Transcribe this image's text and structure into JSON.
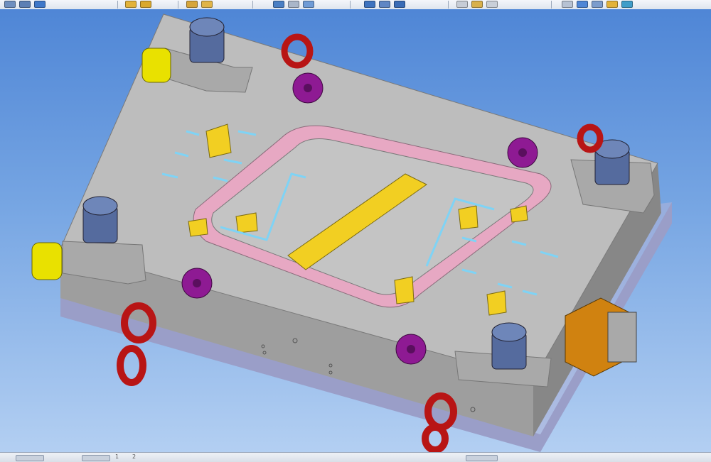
{
  "app": {
    "accent": "#4f86d6",
    "toolbar_icons": [
      "pointer-icon",
      "axis-icon",
      "move-icon",
      "folder-open-icon",
      "folder-icon",
      "assembly-icon",
      "open-assembly-icon",
      "part-icon",
      "sheet-icon",
      "view-icon",
      "window-icon",
      "window-split-icon",
      "window-close-icon",
      "grid-icon",
      "zoom-icon",
      "rotate-icon",
      "cursor-icon",
      "table-icon",
      "link-icon",
      "folder-yellow-icon",
      "export-icon"
    ]
  },
  "model": {
    "name": "injection-mold-assembly",
    "colors": {
      "plate": "#b9b9b9",
      "plate_side": "#9c9c9c",
      "base_plate": "#9a9ec8",
      "groove": "#e7a8c3",
      "insert": "#f2cf22",
      "cooling": "#7fd3f5",
      "bushing": "#556b9e",
      "eyebolt": "#b81515",
      "bolt": "#8e1a93",
      "connector": "#d08210",
      "cylinder": "#e9e100"
    }
  },
  "status": {
    "page_left": "1",
    "page_right": "2"
  }
}
